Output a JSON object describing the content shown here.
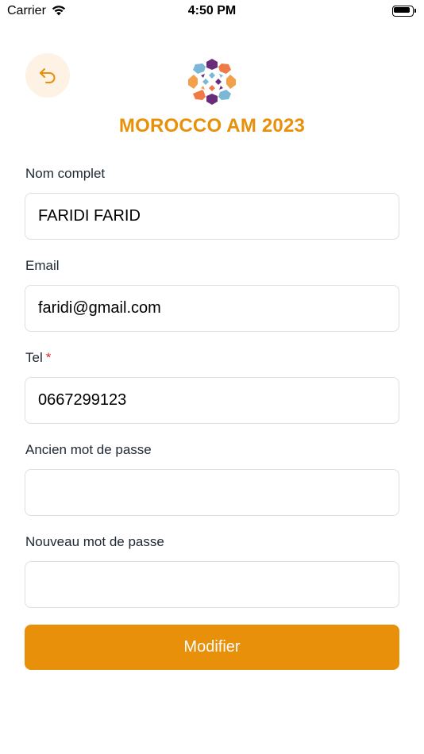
{
  "status_bar": {
    "carrier": "Carrier",
    "time": "4:50 PM"
  },
  "header": {
    "title": "MOROCCO AM 2023"
  },
  "form": {
    "fields": [
      {
        "label": "Nom complet",
        "value": "FARIDI FARID",
        "required": false
      },
      {
        "label": "Email",
        "value": "faridi@gmail.com",
        "required": false
      },
      {
        "label": "Tel",
        "value": "0667299123",
        "required": true,
        "required_mark": "*"
      },
      {
        "label": "Ancien mot de passe",
        "value": "",
        "required": false
      },
      {
        "label": "Nouveau mot de passe",
        "value": "",
        "required": false
      }
    ],
    "submit_label": "Modifier"
  },
  "colors": {
    "accent": "#e8900a",
    "back_button_bg": "#fdf2e4",
    "required": "#d92b2b"
  }
}
